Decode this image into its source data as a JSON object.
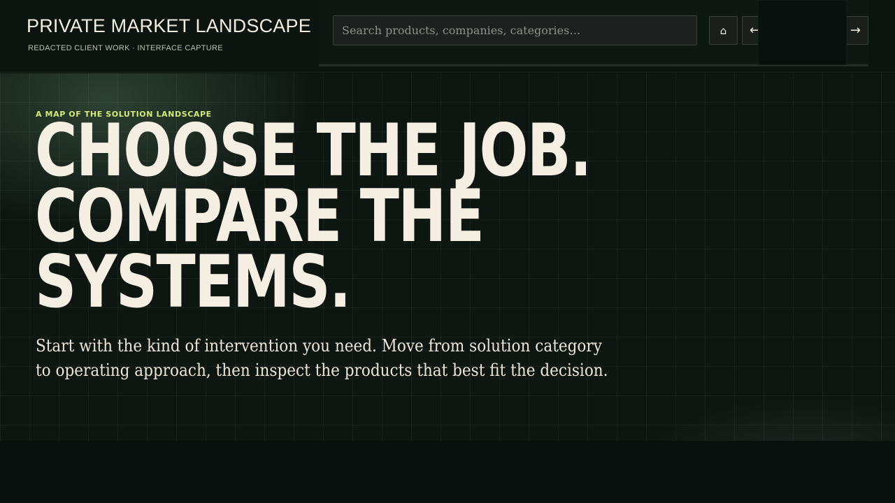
{
  "header": {
    "title": "PRIVATE MARKET LANDSCAPE",
    "subtitle": "REDACTED CLIENT WORK · INTERFACE CAPTURE"
  },
  "search": {
    "placeholder": "Search products, companies, categories…",
    "value": ""
  },
  "nav": {
    "home_icon": "⌂",
    "back_icon": "←",
    "forward_icon": "→"
  },
  "hero": {
    "eyebrow": "A MAP OF THE SOLUTION LANDSCAPE",
    "headline_lines": [
      "CHOOSE THE JOB.",
      "COMPARE THE",
      "SYSTEMS."
    ],
    "lede": "Start with the kind of intervention you need. Move from solution category to operating approach, then inspect the products that best fit the decision."
  },
  "colors": {
    "background": "#0a120e",
    "text": "#f3ede0",
    "accent": "#d4ea7a"
  }
}
